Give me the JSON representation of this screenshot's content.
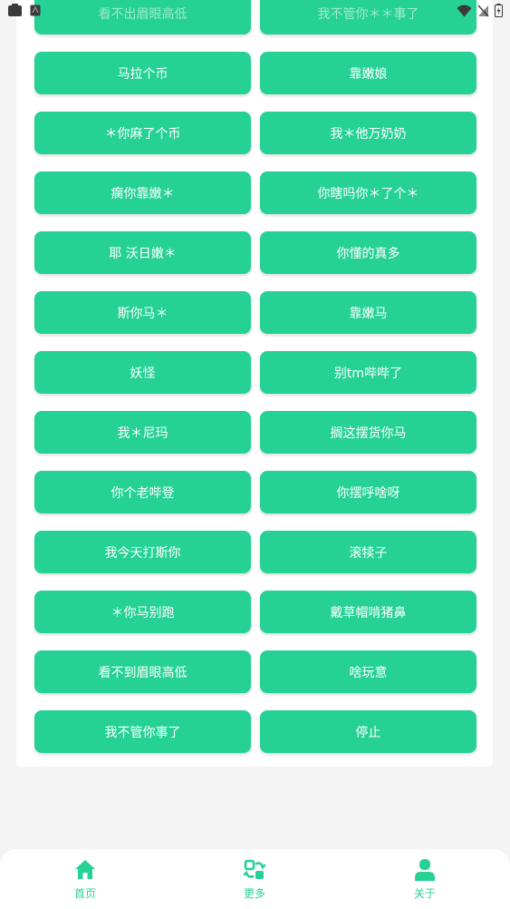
{
  "theme": {
    "accent": "#26d196",
    "background": "#f4f4f4",
    "card": "#ffffff"
  },
  "buttons": [
    "看不出眉眼高低",
    "我不管你＊＊事了",
    "马拉个币",
    "靠嫩娘",
    "＊你麻了个币",
    "我＊他万奶奶",
    "瘸你靠嫩＊",
    "你瞎吗你＊了个＊",
    "耶 沃日嫩＊",
    "你懂的真多",
    "斯你马＊",
    "靠嫩马",
    "妖怪",
    "别tm哔哔了",
    "我＊尼玛",
    "搁这摆货你马",
    "你个老哔登",
    "你摆呼啥呀",
    "我今天打斯你",
    "滚犊子",
    "＊你马别跑",
    "戴草帽啃猪鼻",
    "看不到眉眼高低",
    "啥玩意",
    "我不管你事了",
    "停止"
  ],
  "nav": {
    "home": {
      "label": "首页",
      "icon": "home-icon"
    },
    "more": {
      "label": "更多",
      "icon": "swap-icon"
    },
    "about": {
      "label": "关于",
      "icon": "person-icon"
    }
  },
  "status_bar": {
    "icons": [
      "app-icon",
      "notification-icon",
      "wifi-icon",
      "no-sim-icon",
      "battery-icon"
    ]
  }
}
